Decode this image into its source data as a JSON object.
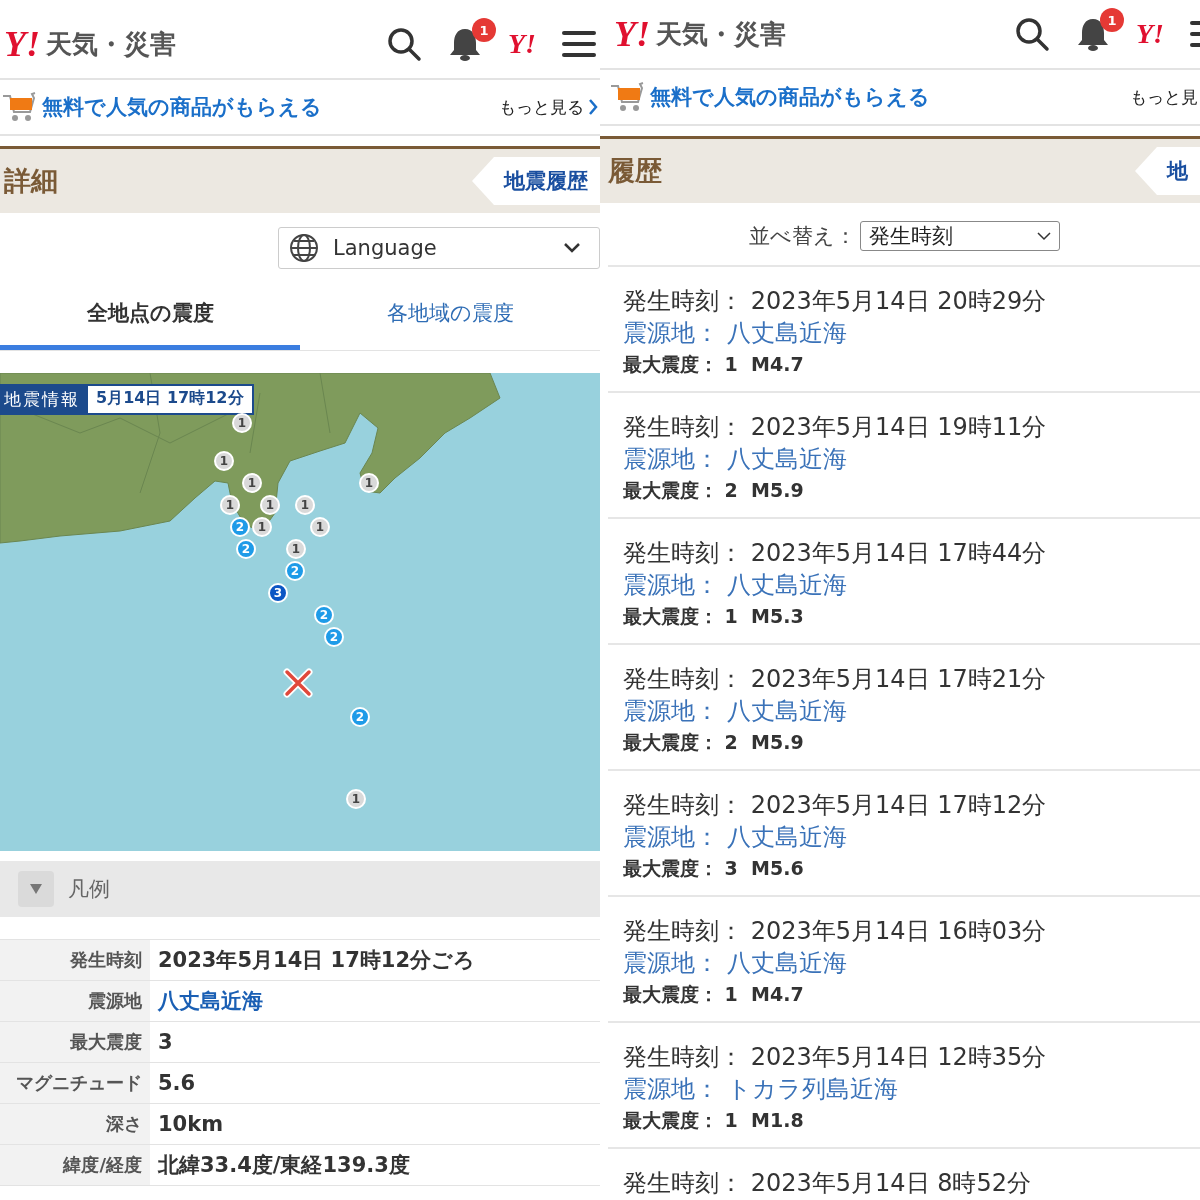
{
  "screens": [
    {
      "kind": "detail",
      "header": {
        "logo": "Y!",
        "title": "天気・災害",
        "notification_count": "1",
        "small_logo": "Y!"
      },
      "promo": {
        "text": "無料で人気の商品がもらえる",
        "more": "もっと見る",
        "more_chevron": true
      },
      "section": {
        "title": "詳細",
        "tab": "地震履歴"
      },
      "language": {
        "label": "Language"
      },
      "tabs": [
        {
          "label": "全地点の震度",
          "selected": true
        },
        {
          "label": "各地域の震度",
          "selected": false
        }
      ],
      "map": {
        "title": "地震情報",
        "time": "5月14日 17時12分",
        "markers": [
          {
            "label": "1",
            "color": "#d9d9d9"
          },
          {
            "label": "1",
            "color": "#d9d9d9"
          },
          {
            "label": "1",
            "color": "#d9d9d9"
          },
          {
            "label": "1",
            "color": "#d9d9d9"
          },
          {
            "label": "1",
            "color": "#d9d9d9"
          },
          {
            "label": "1",
            "color": "#d9d9d9"
          },
          {
            "label": "1",
            "color": "#d9d9d9"
          },
          {
            "label": "2",
            "color": "#1e9be8"
          },
          {
            "label": "1",
            "color": "#d9d9d9"
          },
          {
            "label": "1",
            "color": "#d9d9d9"
          },
          {
            "label": "2",
            "color": "#1e9be8"
          },
          {
            "label": "1",
            "color": "#d9d9d9"
          },
          {
            "label": "2",
            "color": "#1e9be8"
          },
          {
            "label": "3",
            "color": "#0b56c4"
          },
          {
            "label": "2",
            "color": "#1e9be8"
          },
          {
            "label": "2",
            "color": "#1e9be8"
          },
          {
            "label": "2",
            "color": "#1e9be8"
          },
          {
            "label": "1",
            "color": "#d9d9d9"
          }
        ]
      },
      "legend": {
        "label": "凡例"
      },
      "details": [
        {
          "label": "発生時刻",
          "value": "2023年5月14日 17時12分ごろ",
          "kind": "text"
        },
        {
          "label": "震源地",
          "value": "八丈島近海",
          "kind": "link"
        },
        {
          "label": "最大震度",
          "value": "3",
          "kind": "text"
        },
        {
          "label": "マグニチュード",
          "value": "5.6",
          "kind": "text"
        },
        {
          "label": "深さ",
          "value": "10km",
          "kind": "text"
        },
        {
          "label": "緯度/経度",
          "value": "北緯33.4度/東経139.3度",
          "kind": "text"
        }
      ]
    },
    {
      "kind": "history",
      "header": {
        "logo": "Y!",
        "title": "天気・災害",
        "notification_count": "1",
        "small_logo": "Y!"
      },
      "promo": {
        "text": "無料で人気の商品がもらえる",
        "more": "もっと見",
        "more_chevron": false
      },
      "section": {
        "title": "履歴",
        "tab": "地"
      },
      "sort": {
        "label": "並べ替え：",
        "value": "発生時刻"
      },
      "entries": [
        {
          "time_label": "発生時刻：",
          "time": "2023年5月14日 20時29分",
          "epicenter_label": "震源地：",
          "epicenter": "八丈島近海",
          "intensity_label": "最大震度：",
          "intensity": "1",
          "magnitude": "M4.7"
        },
        {
          "time_label": "発生時刻：",
          "time": "2023年5月14日 19時11分",
          "epicenter_label": "震源地：",
          "epicenter": "八丈島近海",
          "intensity_label": "最大震度：",
          "intensity": "2",
          "magnitude": "M5.9"
        },
        {
          "time_label": "発生時刻：",
          "time": "2023年5月14日 17時44分",
          "epicenter_label": "震源地：",
          "epicenter": "八丈島近海",
          "intensity_label": "最大震度：",
          "intensity": "1",
          "magnitude": "M5.3"
        },
        {
          "time_label": "発生時刻：",
          "time": "2023年5月14日 17時21分",
          "epicenter_label": "震源地：",
          "epicenter": "八丈島近海",
          "intensity_label": "最大震度：",
          "intensity": "2",
          "magnitude": "M5.9"
        },
        {
          "time_label": "発生時刻：",
          "time": "2023年5月14日 17時12分",
          "epicenter_label": "震源地：",
          "epicenter": "八丈島近海",
          "intensity_label": "最大震度：",
          "intensity": "3",
          "magnitude": "M5.6"
        },
        {
          "time_label": "発生時刻：",
          "time": "2023年5月14日 16時03分",
          "epicenter_label": "震源地：",
          "epicenter": "八丈島近海",
          "intensity_label": "最大震度：",
          "intensity": "1",
          "magnitude": "M4.7"
        },
        {
          "time_label": "発生時刻：",
          "time": "2023年5月14日 12時35分",
          "epicenter_label": "震源地：",
          "epicenter": "トカラ列島近海",
          "intensity_label": "最大震度：",
          "intensity": "1",
          "magnitude": "M1.8"
        },
        {
          "time_label": "発生時刻：",
          "time": "2023年5月14日 8時52分"
        }
      ]
    }
  ]
}
